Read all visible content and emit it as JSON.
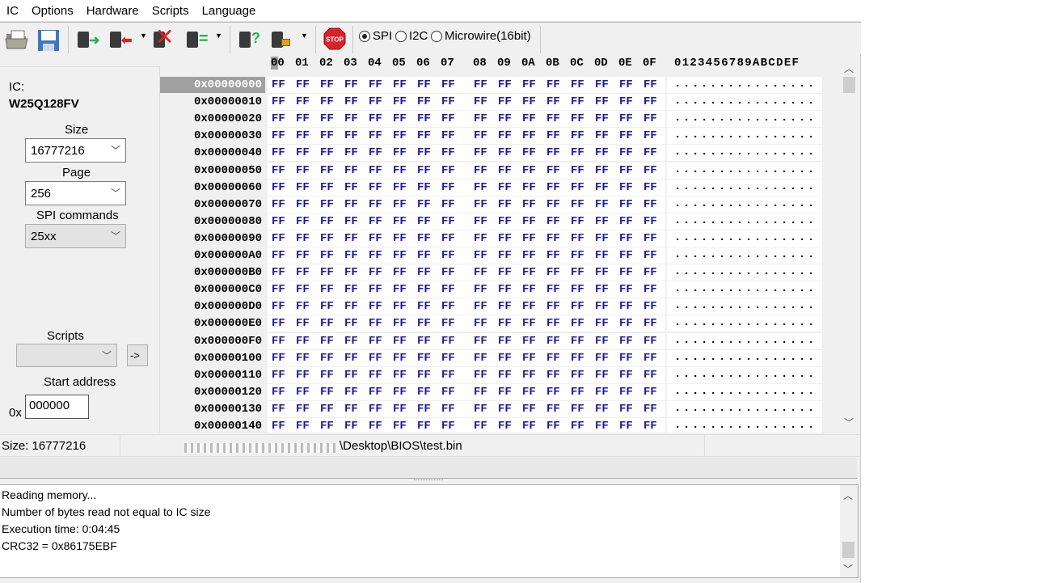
{
  "menu": [
    "IC",
    "Options",
    "Hardware",
    "Scripts",
    "Language"
  ],
  "protocols": {
    "spi": "SPI",
    "i2c": "I2C",
    "microwire": "Microwire(16bit)",
    "selected": "SPI"
  },
  "toolbar": {
    "stop": "STOP"
  },
  "ic": {
    "label": "IC:",
    "name": "W25Q128FV",
    "size_label": "Size",
    "size": "16777216",
    "page_label": "Page",
    "page": "256",
    "spi_label": "SPI commands",
    "spi": "25xx",
    "scripts_label": "Scripts",
    "scripts": "",
    "run_button": "->",
    "start_label": "Start address",
    "prefix": "0x",
    "start": "000000"
  },
  "hex": {
    "columns": [
      "00",
      "01",
      "02",
      "03",
      "04",
      "05",
      "06",
      "07",
      "08",
      "09",
      "0A",
      "0B",
      "0C",
      "0D",
      "0E",
      "0F"
    ],
    "ascii_header": "0123456789ABCDEF",
    "rows": [
      {
        "addr": "0x00000000",
        "bytes": "FF FF FF FF FF FF FF FF FF FF FF FF FF FF FF FF",
        "ascii": "................"
      },
      {
        "addr": "0x00000010",
        "bytes": "FF FF FF FF FF FF FF FF FF FF FF FF FF FF FF FF",
        "ascii": "................"
      },
      {
        "addr": "0x00000020",
        "bytes": "FF FF FF FF FF FF FF FF FF FF FF FF FF FF FF FF",
        "ascii": "................"
      },
      {
        "addr": "0x00000030",
        "bytes": "FF FF FF FF FF FF FF FF FF FF FF FF FF FF FF FF",
        "ascii": "................"
      },
      {
        "addr": "0x00000040",
        "bytes": "FF FF FF FF FF FF FF FF FF FF FF FF FF FF FF FF",
        "ascii": "................"
      },
      {
        "addr": "0x00000050",
        "bytes": "FF FF FF FF FF FF FF FF FF FF FF FF FF FF FF FF",
        "ascii": "................"
      },
      {
        "addr": "0x00000060",
        "bytes": "FF FF FF FF FF FF FF FF FF FF FF FF FF FF FF FF",
        "ascii": "................"
      },
      {
        "addr": "0x00000070",
        "bytes": "FF FF FF FF FF FF FF FF FF FF FF FF FF FF FF FF",
        "ascii": "................"
      },
      {
        "addr": "0x00000080",
        "bytes": "FF FF FF FF FF FF FF FF FF FF FF FF FF FF FF FF",
        "ascii": "................"
      },
      {
        "addr": "0x00000090",
        "bytes": "FF FF FF FF FF FF FF FF FF FF FF FF FF FF FF FF",
        "ascii": "................"
      },
      {
        "addr": "0x000000A0",
        "bytes": "FF FF FF FF FF FF FF FF FF FF FF FF FF FF FF FF",
        "ascii": "................"
      },
      {
        "addr": "0x000000B0",
        "bytes": "FF FF FF FF FF FF FF FF FF FF FF FF FF FF FF FF",
        "ascii": "................"
      },
      {
        "addr": "0x000000C0",
        "bytes": "FF FF FF FF FF FF FF FF FF FF FF FF FF FF FF FF",
        "ascii": "................"
      },
      {
        "addr": "0x000000D0",
        "bytes": "FF FF FF FF FF FF FF FF FF FF FF FF FF FF FF FF",
        "ascii": "................"
      },
      {
        "addr": "0x000000E0",
        "bytes": "FF FF FF FF FF FF FF FF FF FF FF FF FF FF FF FF",
        "ascii": "................"
      },
      {
        "addr": "0x000000F0",
        "bytes": "FF FF FF FF FF FF FF FF FF FF FF FF FF FF FF FF",
        "ascii": "................"
      },
      {
        "addr": "0x00000100",
        "bytes": "FF FF FF FF FF FF FF FF FF FF FF FF FF FF FF FF",
        "ascii": "................"
      },
      {
        "addr": "0x00000110",
        "bytes": "FF FF FF FF FF FF FF FF FF FF FF FF FF FF FF FF",
        "ascii": "................"
      },
      {
        "addr": "0x00000120",
        "bytes": "FF FF FF FF FF FF FF FF FF FF FF FF FF FF FF FF",
        "ascii": "................"
      },
      {
        "addr": "0x00000130",
        "bytes": "FF FF FF FF FF FF FF FF FF FF FF FF FF FF FF FF",
        "ascii": "................"
      },
      {
        "addr": "0x00000140",
        "bytes": "FF FF FF FF FF FF FF FF FF FF FF FF FF FF FF FF",
        "ascii": "................"
      }
    ]
  },
  "status": {
    "size": "Size: 16777216",
    "file": "\\Desktop\\BIOS\\test.bin"
  },
  "log": [
    "Reading memory...",
    "Number of bytes read not equal to IC size",
    "Execution time: 0:04:45",
    "CRC32 = 0x86175EBF"
  ],
  "colors": {
    "hex_text": "#1a1a9c",
    "selected_addr": "#a0a0a0",
    "stop": "#d8232a"
  }
}
